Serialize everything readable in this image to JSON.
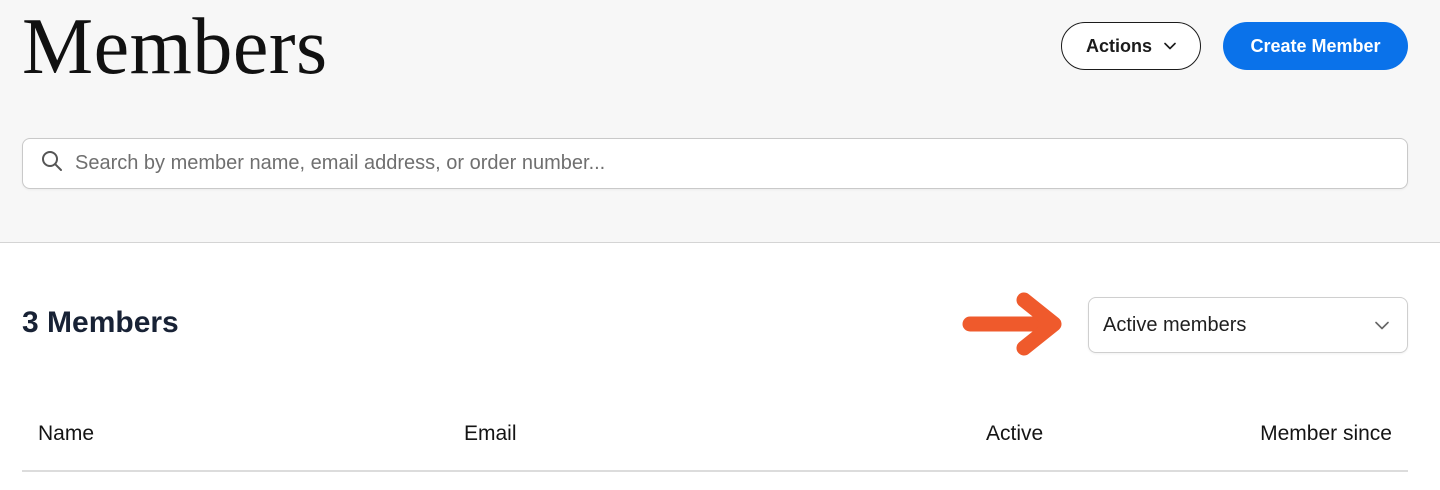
{
  "header": {
    "title": "Members",
    "actions_label": "Actions",
    "create_label": "Create Member"
  },
  "search": {
    "placeholder": "Search by member name, email address, or order number...",
    "value": ""
  },
  "summary": {
    "count_label": "3 Members"
  },
  "filter": {
    "selected": "Active members"
  },
  "table": {
    "columns": [
      "Name",
      "Email",
      "Active",
      "Member since"
    ]
  },
  "icons": {
    "search": "search-icon",
    "chevron": "chevron-down-icon",
    "annotation": "arrow-right-icon"
  },
  "colors": {
    "accent": "#0a72ea",
    "annotation": "#ef5a2c",
    "title": "#111111"
  }
}
